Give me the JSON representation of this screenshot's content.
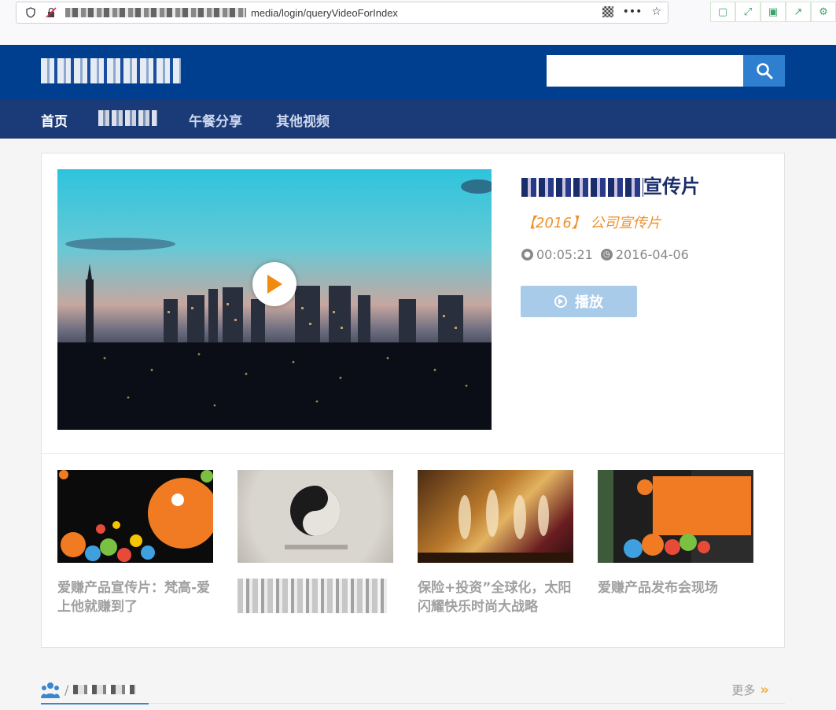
{
  "browser": {
    "url_path": "media/login/queryVideoForIndex",
    "extensions": [
      "bookmark-icon",
      "expand-icon",
      "save-icon",
      "share-icon",
      "settings-icon"
    ]
  },
  "header": {
    "search_placeholder": ""
  },
  "nav": {
    "items": [
      {
        "label": "首页",
        "active": true
      },
      {
        "label": "午餐分享",
        "active": false
      },
      {
        "label": "其他视频",
        "active": false
      }
    ]
  },
  "featured": {
    "title_suffix": "宣传片",
    "subtitle": "【2016】 公司宣传片",
    "duration": "00:05:21",
    "date": "2016-04-06",
    "play_label": "播放"
  },
  "thumbnails": [
    {
      "caption": "爱赚产品宣传片：梵高-爱上他就赚到了"
    },
    {
      "caption": ""
    },
    {
      "caption": "保险+投资”全球化，太阳闪耀快乐时尚大战略"
    },
    {
      "caption": "爱赚产品发布会现场"
    }
  ],
  "section": {
    "more_label": "更多"
  },
  "colors": {
    "header_bg": "#003f8f",
    "nav_bg": "#1b3a78",
    "accent": "#2f7fd1",
    "orange": "#f0902a"
  }
}
